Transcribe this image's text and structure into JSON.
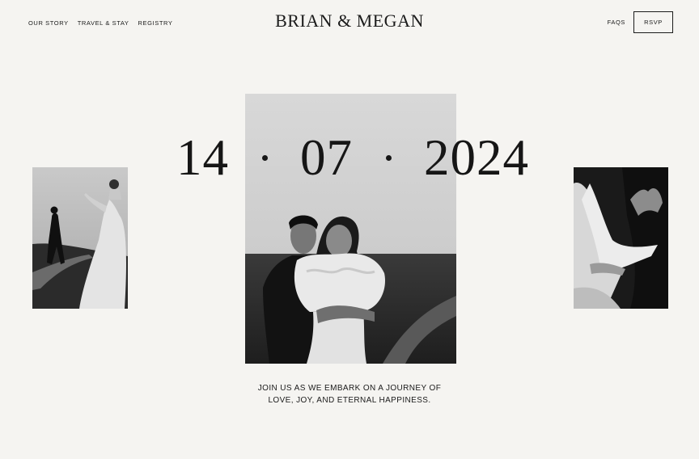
{
  "nav": {
    "left_links": [
      {
        "label": "OUR STORY"
      },
      {
        "label": "TRAVEL & STAY"
      },
      {
        "label": "REGISTRY"
      }
    ],
    "faqs_label": "FAQS",
    "rsvp_label": "RSVP"
  },
  "brand": {
    "title": "BRIAN & MEGAN"
  },
  "hero": {
    "date": {
      "day": "14",
      "month": "07",
      "year": "2024"
    }
  },
  "tagline": {
    "line1": "JOIN US AS WE EMBARK ON A JOURNEY OF",
    "line2": "LOVE, JOY, AND ETERNAL HAPPINESS."
  },
  "colors": {
    "background": "#f5f4f1",
    "text": "#1b1b1b"
  }
}
